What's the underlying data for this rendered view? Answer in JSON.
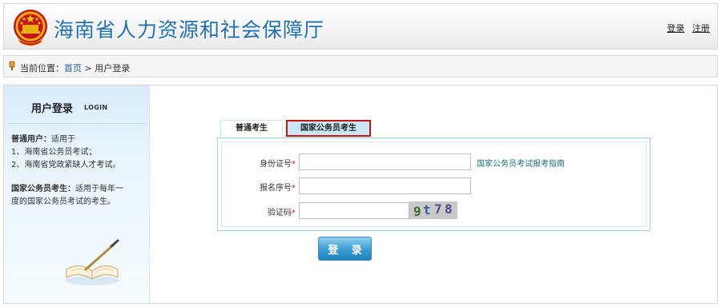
{
  "header": {
    "site_title": "海南省人力资源和社会保障厅",
    "links": {
      "login": "登录",
      "register": "注册"
    },
    "emblem_icon": "national-emblem-icon"
  },
  "breadcrumb": {
    "prefix": "当前位置：",
    "home": "首页",
    "separator": " >",
    "current": "用户登录",
    "icon": "location-pin-icon"
  },
  "sidebar": {
    "title": "用户登录",
    "title_en": "LOGIN",
    "normal_user_label": "普通用户：",
    "normal_user_intro": "适用于",
    "normal_user_items": [
      "1、海南省公务员考试；",
      "2、海南省党政紧缺人才考试。"
    ],
    "civil_label": "国家公务员考生：",
    "civil_text_1": "适用于每年一",
    "civil_text_2": "度的国家公务员考试的考生。",
    "illustration_icon": "book-and-pen-icon"
  },
  "tabs": [
    {
      "label": "普通考生",
      "active": false
    },
    {
      "label": "国家公务员考生",
      "active": true
    }
  ],
  "form": {
    "id_label": "身份证号",
    "reg_label": "报名序号",
    "captcha_label": "验证码",
    "required_mark": "*",
    "id_value": "",
    "reg_value": "",
    "captcha_value": "",
    "guide_link": "国家公务员考试报考指南",
    "captcha_chars": [
      "9",
      "t",
      "7",
      "8"
    ]
  },
  "login_button": "登 录",
  "colors": {
    "title_blue": "#1e6fb3",
    "link_blue": "#1f5fa8",
    "guide_teal": "#1d6f7f",
    "active_tab_border": "#cc1111",
    "required_red": "#dd1111"
  }
}
